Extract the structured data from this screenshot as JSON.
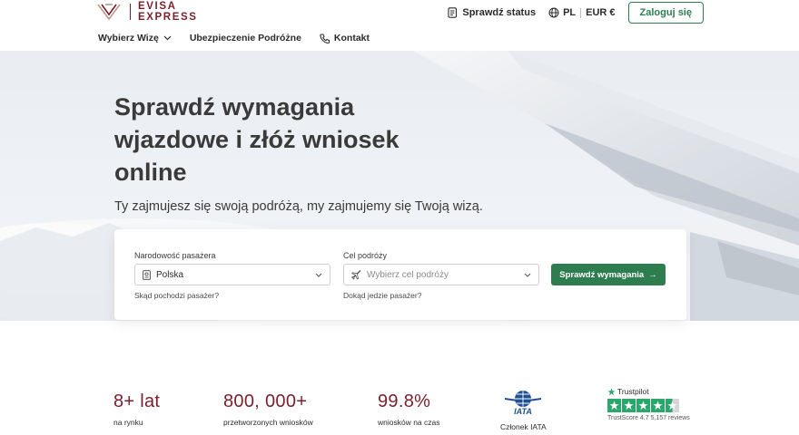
{
  "brand": {
    "line1": "EVISA",
    "line2": "EXPRESS",
    "color": "#7a1f2b"
  },
  "header": {
    "status_label": "Sprawdź status",
    "lang": "PL",
    "currency": "EUR €",
    "login_label": "Zaloguj się"
  },
  "nav": {
    "items": [
      {
        "label": "Wybierz Wizę",
        "icon": "chevron-down-icon"
      },
      {
        "label": "Ubezpieczenie Podróżne"
      },
      {
        "label": "Kontakt",
        "icon": "phone-icon"
      }
    ]
  },
  "hero": {
    "title": "Sprawdź wymagania wjazdowe i złóż wniosek online",
    "subtitle": "Ty zajmujesz się swoją podróżą, my zajmujemy się Twoją wizą."
  },
  "search": {
    "nationality_label": "Narodowość pasażera",
    "nationality_value": "Polska",
    "nationality_helper": "Skąd pochodzi pasażer?",
    "destination_label": "Cel podróży",
    "destination_placeholder": "Wybierz cel podróży",
    "destination_helper": "Dokąd jedzie pasażer?",
    "cta_label": "Sprawdź wymagania",
    "cta_arrow": "→",
    "accent": "#2e7d4f"
  },
  "stats": [
    {
      "value": "8+ lat",
      "label": "na rynku"
    },
    {
      "value": "800, 000+",
      "label": "przetworzonych wniosków"
    },
    {
      "value": "99.8%",
      "label": "wniosków na czas"
    }
  ],
  "iata": {
    "logo_text": "IATA",
    "label": "Członek IATA"
  },
  "trustpilot": {
    "name": "Trustpilot",
    "stars": 4.5,
    "score_text": "TrustScore 4.7 5,157 reviews"
  }
}
